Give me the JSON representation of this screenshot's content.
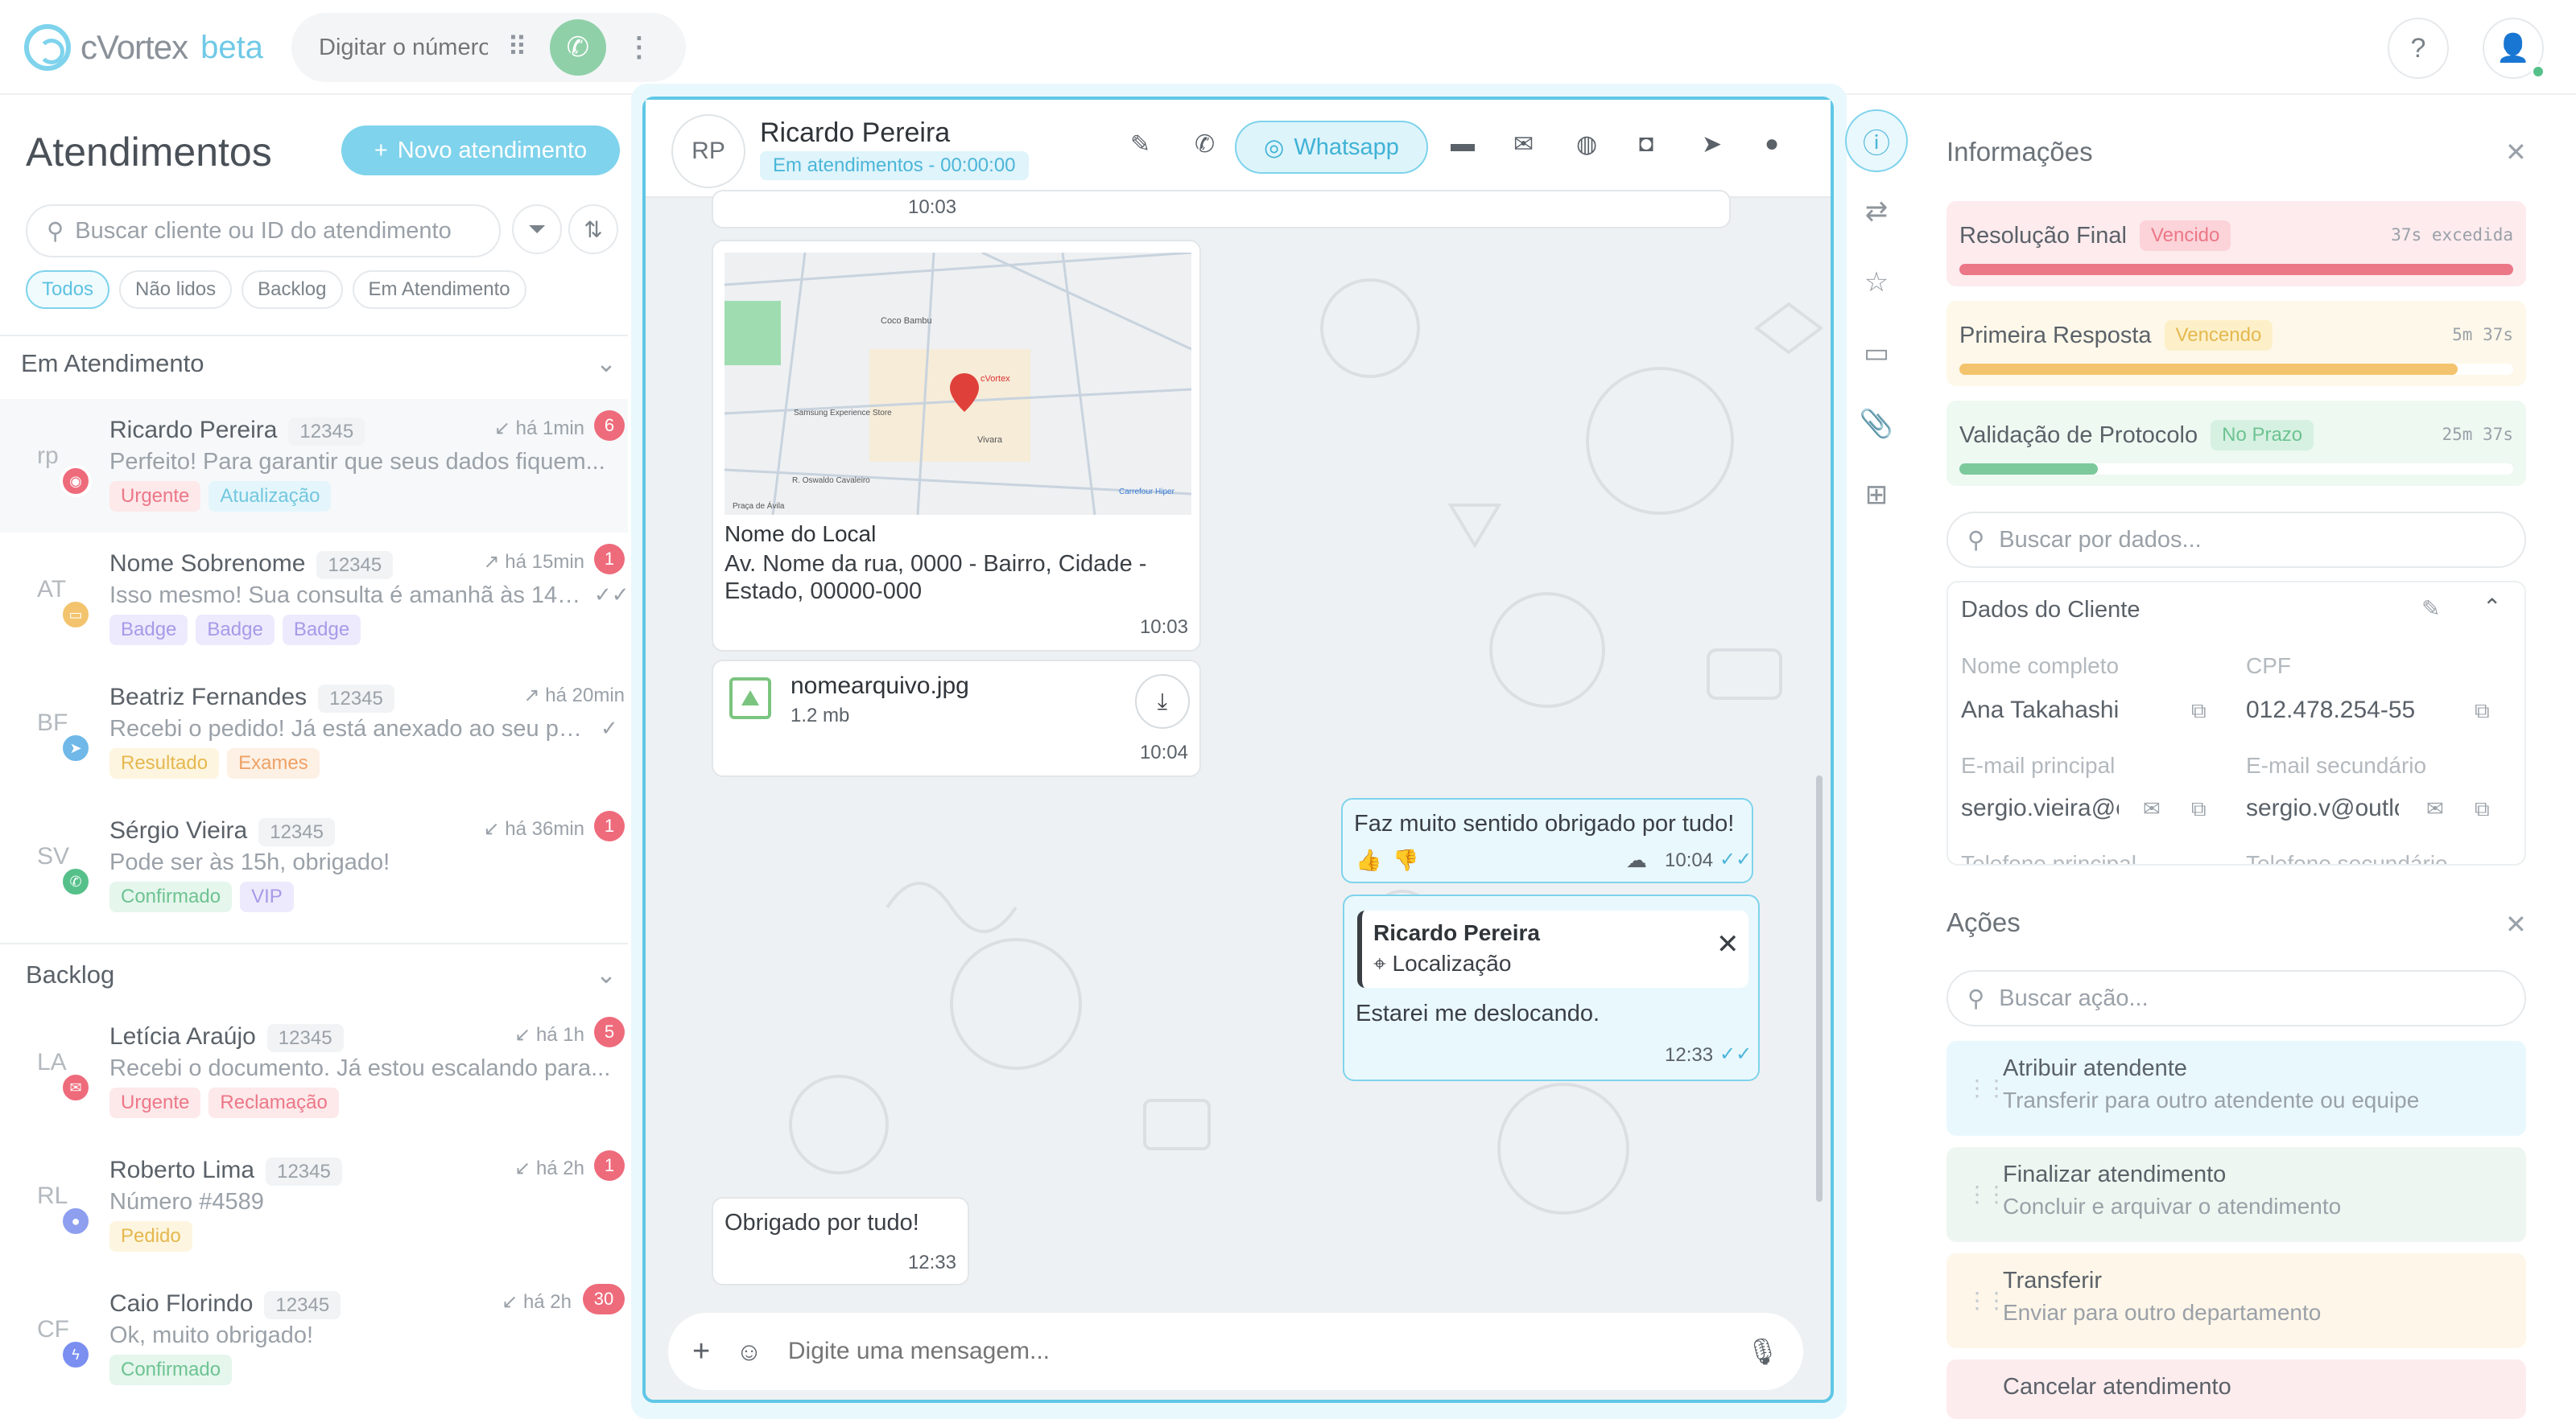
{
  "app": {
    "name": "cVortex",
    "beta": "beta"
  },
  "topbar": {
    "dial_placeholder": "Digitar o número"
  },
  "left": {
    "title": "Atendimentos",
    "new_button": "Novo atendimento",
    "search_placeholder": "Buscar cliente ou ID do atendimento",
    "filters": [
      "Todos",
      "Não lidos",
      "Backlog",
      "Em Atendimento"
    ],
    "section_active": "Em Atendimento",
    "section_backlog": "Backlog",
    "conversations": [
      {
        "initials": "rp",
        "name": "Ricardo Pereira",
        "id": "12345",
        "time": "há 1min",
        "count": "6",
        "msg": "Perfeito! Para garantir que seus dados fiquem...",
        "tags": [
          "Urgente",
          "Atualização"
        ]
      },
      {
        "initials": "AT",
        "name": "Nome Sobrenome",
        "id": "12345",
        "time": "há 15min",
        "count": "1",
        "msg": "Isso mesmo! Sua consulta é amanhã às 14h...",
        "tags": [
          "Badge",
          "Badge",
          "Badge"
        ]
      },
      {
        "initials": "BF",
        "name": "Beatriz Fernandes",
        "id": "12345",
        "time": "há 20min",
        "count": "",
        "msg": "Recebi o pedido! Já está anexado ao seu pr...",
        "tags": [
          "Resultado",
          "Exames"
        ]
      },
      {
        "initials": "SV",
        "name": "Sérgio Vieira",
        "id": "12345",
        "time": "há 36min",
        "count": "1",
        "msg": "Pode ser às 15h, obrigado!",
        "tags": [
          "Confirmado",
          "VIP"
        ]
      }
    ],
    "backlog": [
      {
        "initials": "LA",
        "name": "Letícia Araújo",
        "id": "12345",
        "time": "há 1h",
        "count": "5",
        "msg": "Recebi o documento. Já estou escalando para...",
        "tags": [
          "Urgente",
          "Reclamação"
        ]
      },
      {
        "initials": "RL",
        "name": "Roberto Lima",
        "id": "12345",
        "time": "há 2h",
        "count": "1",
        "msg": "Número #4589",
        "tags": [
          "Pedido"
        ]
      },
      {
        "initials": "CF",
        "name": "Caio Florindo",
        "id": "12345",
        "time": "há 2h",
        "count": "30",
        "msg": "Ok, muito obrigado!",
        "tags": [
          "Confirmado"
        ]
      }
    ]
  },
  "chat": {
    "avatar": "RP",
    "name": "Ricardo Pereira",
    "status": "Em atendimentos - 00:00:00",
    "channel": "Whatsapp",
    "messages": {
      "top_time": "10:03",
      "map_place": "Nome do Local",
      "map_address": "Av. Nome da rua, 0000 - Bairro, Cidade - Estado, 00000-000",
      "map_time": "10:03",
      "map_labels": [
        "Coco Bambu",
        "cVortex",
        "Samsung Experience Store",
        "Vivara",
        "Carrefour Hiper",
        "R. Oswaldo Cavaleiro",
        "Praça de Ávila"
      ],
      "file_name": "nomearquivo.jpg",
      "file_size": "1.2 mb",
      "file_time": "10:04",
      "out1_text": "Faz muito sentido obrigado por tudo!",
      "out1_time": "10:04",
      "reply_name": "Ricardo Pereira",
      "reply_sub": "Localização",
      "out2_text": "Estarei me deslocando.",
      "out2_time": "12:33",
      "in_last_text": "Obrigado por tudo!",
      "in_last_time": "12:33"
    },
    "composer_placeholder": "Digite uma mensagem..."
  },
  "info": {
    "title": "Informações",
    "sla": [
      {
        "name": "Resolução Final",
        "badge": "Vencido",
        "time": "37s excedida",
        "progress": 1.0
      },
      {
        "name": "Primeira Resposta",
        "badge": "Vencendo",
        "time": "5m 37s",
        "progress": 0.9
      },
      {
        "name": "Validação de Protocolo",
        "badge": "No Prazo",
        "time": "25m 37s",
        "progress": 0.25
      }
    ],
    "search_placeholder": "Buscar por dados...",
    "client_title": "Dados do Cliente",
    "fields": {
      "full_name_label": "Nome completo",
      "full_name": "Ana Takahashi",
      "cpf_label": "CPF",
      "cpf": "012.478.254-55",
      "email1_label": "E-mail principal",
      "email1": "sergio.vieira@e",
      "email2_label": "E-mail secundário",
      "email2": "sergio.v@outlo",
      "phone1_label": "Telefone principal",
      "phone2_label": "Telefone secundário"
    }
  },
  "actions": {
    "title": "Ações",
    "search_placeholder": "Buscar ação...",
    "items": [
      {
        "title": "Atribuir atendente",
        "desc": "Transferir para outro atendente ou equipe"
      },
      {
        "title": "Finalizar atendimento",
        "desc": "Concluir e arquivar o atendimento"
      },
      {
        "title": "Transferir",
        "desc": "Enviar para outro departamento"
      },
      {
        "title": "Cancelar atendimento",
        "desc": ""
      }
    ]
  },
  "colors": {
    "accent": "#7fd3ec",
    "danger": "#ee6b7b",
    "warning": "#f3c46d",
    "success": "#6dc392"
  }
}
